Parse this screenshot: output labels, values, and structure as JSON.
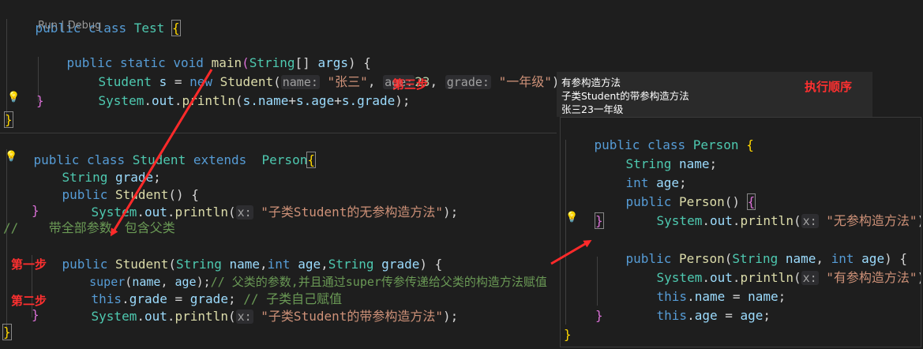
{
  "test_pane": {
    "lines": [
      {
        "k": "public class ",
        "t": "Test ",
        "b": "{"
      },
      {
        "lens": "Run | Debug"
      },
      {
        "k": "public static void ",
        "f": "main",
        "p": "(",
        "t": "String",
        "p2": "[] ",
        "v": "args",
        "p3": ") {"
      },
      {
        "t": "Student ",
        "v": "s ",
        "p": "= ",
        "k": "new ",
        "f": "Student",
        "p2": "(",
        "h1": "name:",
        "s1": "\"张三\"",
        "p3": ", ",
        "h2": "age:",
        "n": "23",
        "p4": ", ",
        "h3": "grade:",
        "s2": "\"一年级\"",
        "p5": ");"
      },
      {
        "t": "System",
        "p": ".",
        "v": "out",
        "p2": ".",
        "f": "println",
        "p3": "(",
        "v2": "s.name",
        "p4": "+",
        "v3": "s.age",
        "p5": "+",
        "v4": "s.grade",
        "p6": ");"
      },
      {
        "b": "}"
      },
      {
        "b": "}"
      }
    ]
  },
  "student_pane": {
    "l1": {
      "k": "public class ",
      "t": "Student ",
      "k2": "extends  ",
      "t2": "Person",
      "b": "{"
    },
    "l2": {
      "t": "String ",
      "v": "grade",
      "p": ";"
    },
    "l3": {
      "k": "public ",
      "f": "Student",
      "p": "() {"
    },
    "l4": {
      "t": "System",
      "p": ".",
      "v": "out",
      "p2": ".",
      "f": "println",
      "p3": "(",
      "h": "x:",
      "s": "\"子类Student的无参构造方法\"",
      "p4": ");"
    },
    "l5": {
      "p": "}"
    },
    "l6": {
      "c": "//    带全部参数，包含父类"
    },
    "l7": {
      "k": "public ",
      "f": "Student",
      "p": "(",
      "t": "String ",
      "v": "name",
      "p2": ",",
      "k2": "int ",
      "v2": "age",
      "p3": ",",
      "t2": "String ",
      "v3": "grade",
      "p4": ") {"
    },
    "l8": {
      "k": "super",
      "p": "(",
      "v": "name",
      "p2": ", ",
      "v2": "age",
      "p3": ");",
      "c": "// 父类的参数,并且通过super传参传递给父类的构造方法赋值"
    },
    "l9": {
      "k": "this",
      "p": ".",
      "v": "grade",
      "p2": " = ",
      "v2": "grade",
      "p3": "; ",
      "c": "// 子类自己赋值"
    },
    "l10": {
      "t": "System",
      "p": ".",
      "v": "out",
      "p2": ".",
      "f": "println",
      "p3": "(",
      "h": "x:",
      "s": "\"子类Student的带参构造方法\"",
      "p4": ");"
    },
    "l11": {
      "p": "}"
    },
    "l12": {
      "b": "}"
    }
  },
  "person_pane": {
    "l1": {
      "k": "public class ",
      "t": "Person ",
      "b": "{"
    },
    "l2": {
      "t": "String ",
      "v": "name",
      "p": ";"
    },
    "l3": {
      "k": "int ",
      "v": "age",
      "p": ";"
    },
    "l4": {
      "k": "public ",
      "f": "Person",
      "p": "() ",
      "b": "{"
    },
    "l5": {
      "t": "System",
      "p": ".",
      "v": "out",
      "p2": ".",
      "f": "println",
      "p3": "(",
      "h": "x:",
      "s": "\"无参构造方法\"",
      "p4": ");"
    },
    "l6": {
      "b": "}"
    },
    "l7": {
      "k": "public ",
      "f": "Person",
      "p": "(",
      "t": "String ",
      "v": "name",
      "p2": ", ",
      "k2": "int ",
      "v2": "age",
      "p3": ") {"
    },
    "l8": {
      "t": "System",
      "p": ".",
      "v": "out",
      "p2": ".",
      "f": "println",
      "p3": "(",
      "h": "x:",
      "s": "\"有参构造方法\"",
      "p4": ");"
    },
    "l9": {
      "k": "this",
      "p": ".",
      "v": "name",
      "p2": " = ",
      "v2": "name",
      "p3": ";"
    },
    "l10": {
      "k": "this",
      "p": ".",
      "v": "age",
      "p2": " = ",
      "v2": "age",
      "p3": ";"
    },
    "l11": {
      "p": "}"
    },
    "l12": {
      "b": "}"
    }
  },
  "output": {
    "line1": "有参构造方法",
    "line2": "子类Student的带参构造方法",
    "line3": "张三23一年级",
    "order_label": "执行顺序"
  },
  "steps": {
    "step1": "第一步",
    "step2": "第二步",
    "step3": "第三步"
  },
  "icons": {
    "lightbulb": "lightbulb-icon",
    "arrow": "red-arrow"
  },
  "colors": {
    "annotation_red": "#ff3030",
    "keyword": "#569cd6",
    "type": "#4ec9b0",
    "string": "#ce9178",
    "comment": "#6a9955"
  }
}
